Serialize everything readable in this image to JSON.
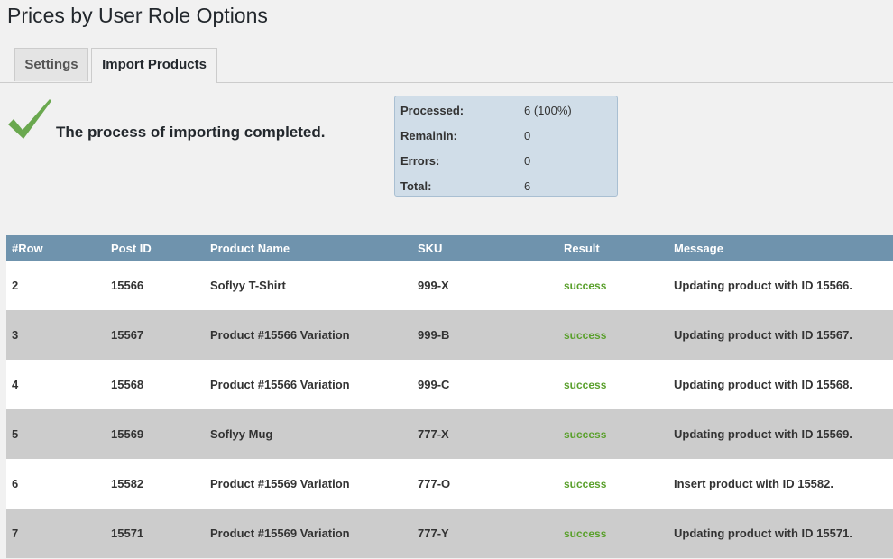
{
  "page": {
    "title": "Prices by User Role Options"
  },
  "tabs": [
    {
      "label": "Settings",
      "active": false
    },
    {
      "label": "Import Products",
      "active": true
    }
  ],
  "status": {
    "icon": "checkmark-icon",
    "message": "The process of importing completed.",
    "accent_color": "#6aa84f"
  },
  "stats": {
    "processed_label": "Processed:",
    "processed_value": "6 (100%)",
    "remaining_label": "Remainin:",
    "remaining_value": "0",
    "errors_label": "Errors:",
    "errors_value": "0",
    "total_label": "Total:",
    "total_value": "6"
  },
  "table": {
    "header_color": "#6f93ad",
    "columns": [
      "#Row",
      "Post ID",
      "Product Name",
      "SKU",
      "Result",
      "Message"
    ],
    "rows": [
      [
        "2",
        "15566",
        "Soflyy T-Shirt",
        "999-X",
        "success",
        "Updating product with ID 15566."
      ],
      [
        "3",
        "15567",
        "Product #15566 Variation",
        "999-B",
        "success",
        "Updating product with ID 15567."
      ],
      [
        "4",
        "15568",
        "Product #15566 Variation",
        "999-C",
        "success",
        "Updating product with ID 15568."
      ],
      [
        "5",
        "15569",
        "Soflyy Mug",
        "777-X",
        "success",
        "Updating product with ID 15569."
      ],
      [
        "6",
        "15582",
        "Product #15569 Variation",
        "777-O",
        "success",
        "Insert product with ID 15582."
      ],
      [
        "7",
        "15571",
        "Product #15569 Variation",
        "777-Y",
        "success",
        "Updating product with ID 15571."
      ]
    ]
  }
}
